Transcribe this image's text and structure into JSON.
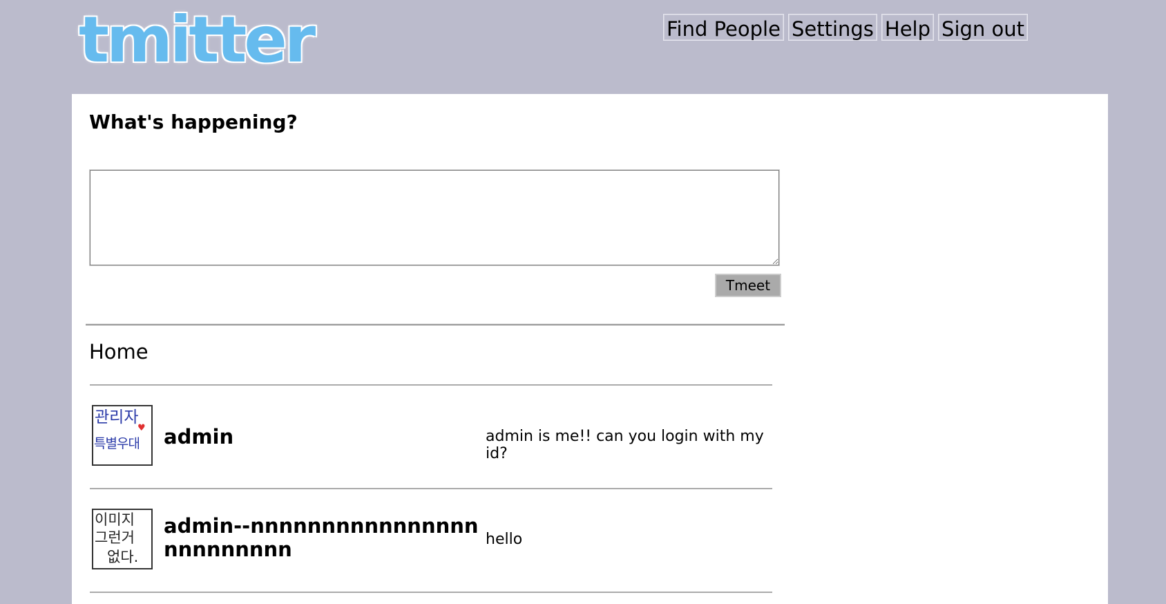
{
  "brand": {
    "logo_text": "tmitter",
    "logo_color": "#66bbee"
  },
  "nav": {
    "items": [
      {
        "label": "Find People"
      },
      {
        "label": "Settings"
      },
      {
        "label": "Help"
      },
      {
        "label": "Sign out"
      }
    ]
  },
  "composer": {
    "heading": "What's happening?",
    "value": "",
    "submit_label": "Tmeet"
  },
  "feed": {
    "title": "Home",
    "tweets": [
      {
        "username": "admin",
        "text": "admin is me!! can you login with my id?",
        "avatar": {
          "line1": "관리자",
          "line2": "특별우대",
          "color": "#2a3aa8"
        }
      },
      {
        "username": "admin--nnnnnnnnnnnnnnnnnnnnnnnnn",
        "text": "hello",
        "avatar": {
          "line1": "이미지",
          "line2": "그런거",
          "line3": "없다.",
          "color": "#222222"
        }
      }
    ]
  }
}
